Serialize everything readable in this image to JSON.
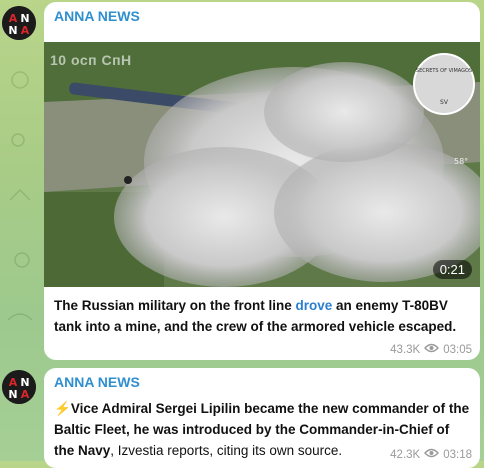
{
  "channel": {
    "avatar_letters": [
      "A",
      "N",
      "N",
      "A"
    ],
    "name": "ANNA NEWS"
  },
  "messages": [
    {
      "sender": "ANNA NEWS",
      "video": {
        "overlay_text": "10 осп СпН",
        "watermark_text": "SECRETS OF VIMAGOS",
        "watermark_small": "SV",
        "degree_label": "58°",
        "duration": "0:21"
      },
      "text_before_link": "The Russian military on the front line ",
      "link_text": "drove",
      "text_after_link": " an enemy T-80BV tank into a mine, and the crew of the armored vehicle escaped.",
      "views": "43.3K",
      "time": "03:05"
    },
    {
      "sender": "ANNA NEWS",
      "prefix_icon": "lightning-icon",
      "bold_text": "Vice Admiral Sergei Lipilin became the new commander of the Baltic Fleet, he was introduced by the Commander-in-Chief of the Navy",
      "plain_text": ", Izvestia reports, citing its own source.",
      "views": "42.3K",
      "time": "03:18"
    }
  ],
  "colors": {
    "sender": "#2f8fcf",
    "link": "#2a7fd0",
    "avatar_bg": "#1b1b1b",
    "avatar_red": "#d8262b"
  }
}
